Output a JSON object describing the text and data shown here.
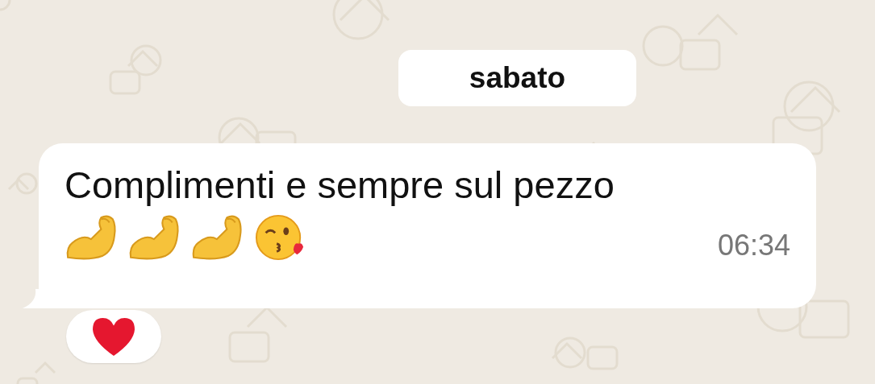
{
  "date_chip": "sabato",
  "message": {
    "text": "Complimenti e sempre sul pezzo",
    "emojis": [
      {
        "kind": "biceps"
      },
      {
        "kind": "biceps"
      },
      {
        "kind": "biceps"
      },
      {
        "kind": "kiss"
      }
    ],
    "time": "06:34",
    "reaction": {
      "kind": "heart"
    }
  }
}
